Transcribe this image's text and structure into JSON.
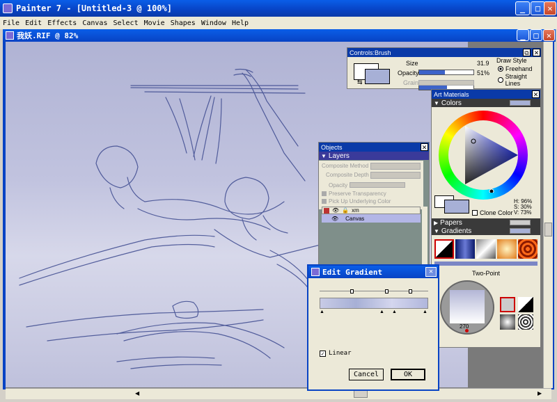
{
  "app": {
    "title": "Painter 7 - [Untitled-3 @ 100%]",
    "minimize": "_",
    "maximize": "□",
    "close": "✕"
  },
  "menu": [
    "File",
    "Edit",
    "Effects",
    "Canvas",
    "Select",
    "Movie",
    "Shapes",
    "Window",
    "Help"
  ],
  "document": {
    "title": "我妖.RIF @ 82%"
  },
  "controls_brush": {
    "title": "Controls:Brush",
    "size_label": "Size",
    "size_value": "31.9",
    "size_level": 0.48,
    "opacity_label": "Opacity",
    "opacity_value": "51%",
    "opacity_level": 0.51,
    "grain_label": "Grain",
    "draw_style_label": "Draw Style",
    "freehand": "Freehand",
    "straight_lines": "Straight Lines"
  },
  "art_materials": {
    "title": "Art Materials",
    "colors_label": "Colors",
    "h": "H: 96%",
    "s": "S: 30%",
    "v": "V: 73%",
    "clone_color": "Clone Color",
    "papers_label": "Papers",
    "gradients_label": "Gradients",
    "gradient_type": "Two-Point",
    "angle": "270"
  },
  "objects": {
    "title": "Objects",
    "layers_label": "Layers",
    "composite_method": "Composite Method",
    "composite_depth": "Composite Depth",
    "opacity": "Opacity",
    "preserve_transparency": "Preserve Transparency",
    "pick_up_underlying": "Pick Up Underlying Color",
    "layer_xm": "xm",
    "layer_canvas": "Canvas"
  },
  "edit_gradient": {
    "title": "Edit Gradient",
    "linear": "Linear",
    "cancel": "Cancel",
    "ok": "OK"
  },
  "colors": {
    "title_blue": "#0843c4",
    "selected_color": "#a7b0d6",
    "canvas_top": "#b0b3d4",
    "sketch_line": "#3d4a8f"
  }
}
